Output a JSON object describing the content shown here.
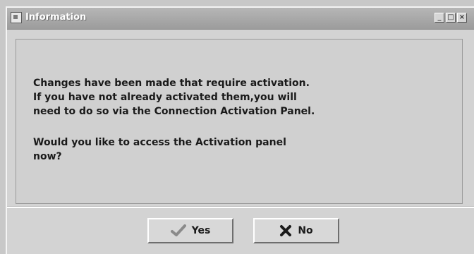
{
  "window": {
    "title": "Information"
  },
  "message": {
    "lines_1": "Changes have been made that require activation.\nIf you have not already activated them,you will\nneed to do so via the Connection Activation Panel.",
    "lines_2": "Would you like to access the Activation panel\nnow?"
  },
  "buttons": {
    "yes_label": "Yes",
    "yes_icon": "checkmark-icon",
    "no_label": "No",
    "no_icon": "x-icon"
  }
}
